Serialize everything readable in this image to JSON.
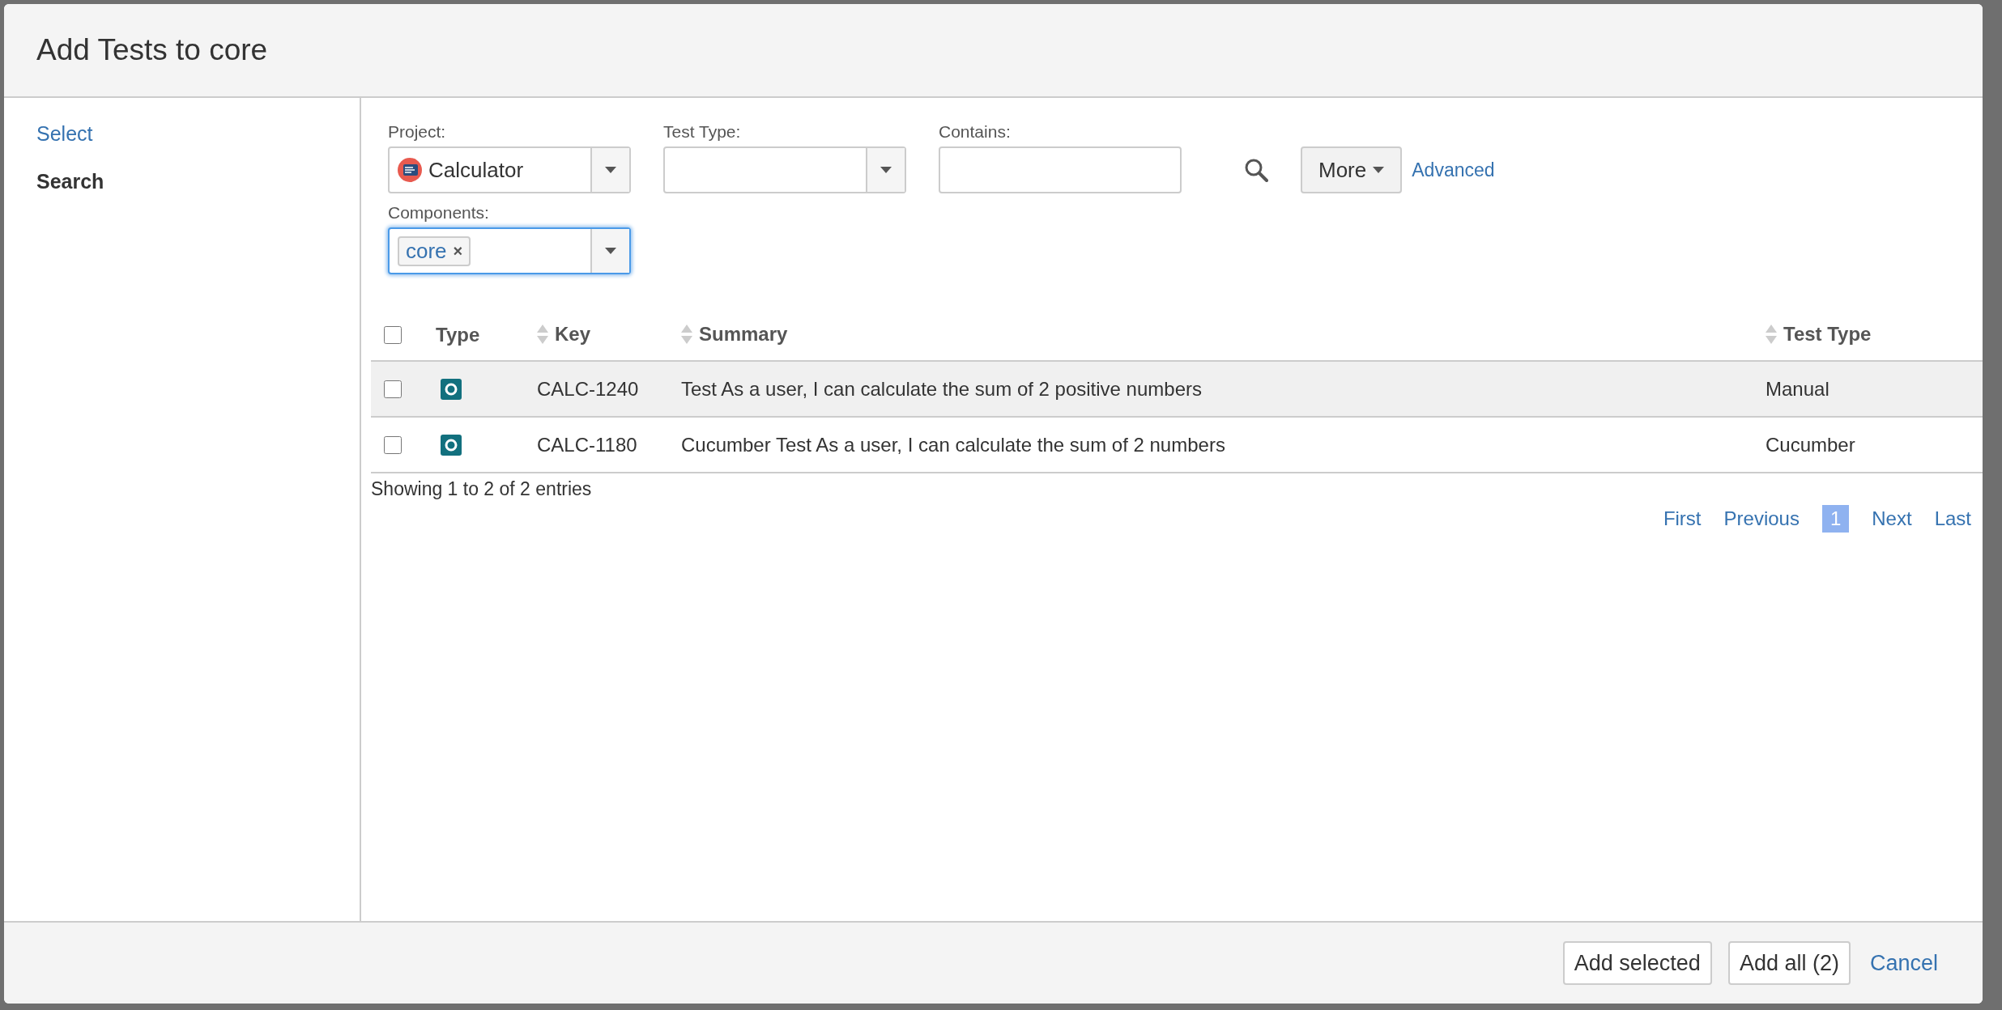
{
  "dialog": {
    "title": "Add Tests to core"
  },
  "sidebar": {
    "items": [
      {
        "label": "Select",
        "selected": false
      },
      {
        "label": "Search",
        "selected": true
      }
    ]
  },
  "filters": {
    "project": {
      "label": "Project:",
      "value": "Calculator"
    },
    "test_type": {
      "label": "Test Type:"
    },
    "contains": {
      "label": "Contains:"
    },
    "more_button": "More",
    "advanced_link": "Advanced",
    "components": {
      "label": "Components:",
      "tags": [
        {
          "label": "core",
          "remove": "×"
        }
      ],
      "focused": true
    }
  },
  "table": {
    "select_all": {
      "checked": false
    },
    "columns": [
      {
        "label": "Type",
        "sortable": false
      },
      {
        "label": "Key",
        "sortable": true
      },
      {
        "label": "Summary",
        "sortable": true
      },
      {
        "label": "Test Type",
        "sortable": true
      }
    ],
    "rows": [
      {
        "checked": false,
        "highlighted": true,
        "key": "CALC-1240",
        "summary": "Test As a user, I can calculate the sum of 2 positive numbers",
        "test_type": "Manual"
      },
      {
        "checked": false,
        "highlighted": false,
        "key": "CALC-1180",
        "summary": "Cucumber Test As a user, I can calculate the sum of 2 numbers",
        "test_type": "Cucumber"
      }
    ],
    "info": "Showing 1 to 2 of 2 entries",
    "pagination": [
      {
        "label": "First",
        "selected": false
      },
      {
        "label": "Previous",
        "selected": false
      },
      {
        "label": "1",
        "selected": true
      },
      {
        "label": "Next",
        "selected": false
      },
      {
        "label": "Last",
        "selected": false
      }
    ]
  },
  "footer": {
    "buttons": [
      {
        "label": "Add selected",
        "kind": "button"
      },
      {
        "label": "Add all (2)",
        "kind": "button"
      },
      {
        "label": "Cancel",
        "kind": "link"
      }
    ]
  }
}
